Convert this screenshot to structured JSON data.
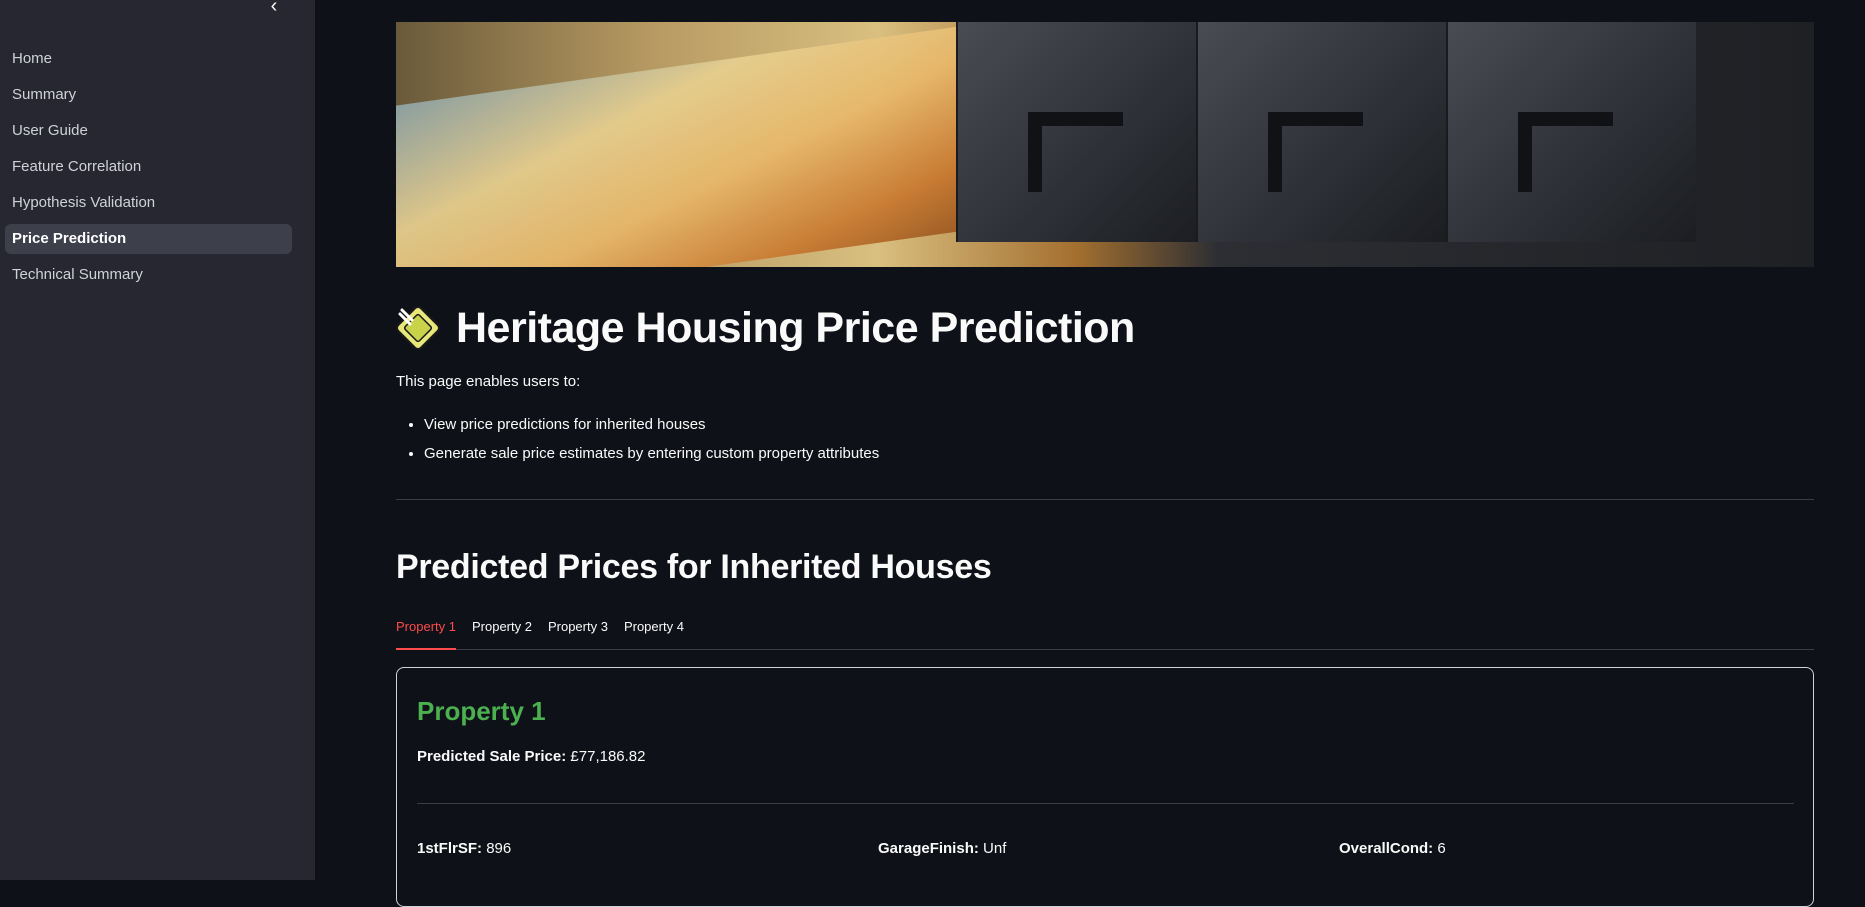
{
  "sidebar": {
    "items": [
      {
        "label": "Home",
        "active": false
      },
      {
        "label": "Summary",
        "active": false
      },
      {
        "label": "User Guide",
        "active": false
      },
      {
        "label": "Feature Correlation",
        "active": false
      },
      {
        "label": "Hypothesis Validation",
        "active": false
      },
      {
        "label": "Price Prediction",
        "active": true
      },
      {
        "label": "Technical Summary",
        "active": false
      }
    ]
  },
  "header": {
    "title": "Heritage Housing Price Prediction",
    "icon": "house-price-emoji-icon"
  },
  "intro": {
    "text": "This page enables users to:",
    "bullets": [
      "View price predictions for inherited houses",
      "Generate sale price estimates by entering custom property attributes"
    ]
  },
  "section": {
    "title": "Predicted Prices for Inherited Houses",
    "tabs": [
      "Property 1",
      "Property 2",
      "Property 3",
      "Property 4"
    ],
    "active_tab": 0
  },
  "card": {
    "title": "Property 1",
    "price_label": "Predicted Sale Price:",
    "price_value": "£77,186.82",
    "attributes": [
      {
        "label": "1stFlrSF:",
        "value": "896"
      },
      {
        "label": "GarageFinish:",
        "value": "Unf"
      },
      {
        "label": "OverallCond:",
        "value": "6"
      }
    ]
  },
  "colors": {
    "accent": "#ff4b4b",
    "card_title": "#4caf50",
    "background": "#0e1117",
    "sidebar": "#262730"
  }
}
